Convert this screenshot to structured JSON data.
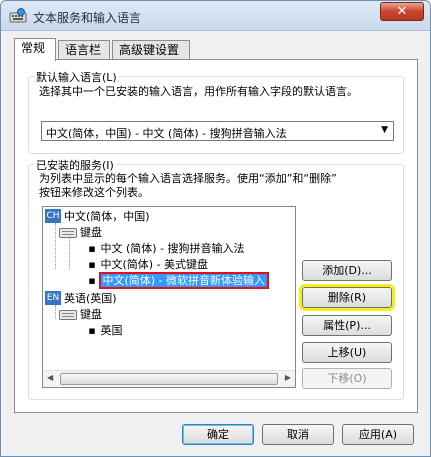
{
  "window": {
    "title": "文本服务和输入语言",
    "close_symbol": "✕"
  },
  "tabs": [
    {
      "label": "常规"
    },
    {
      "label": "语言栏"
    },
    {
      "label": "高级键设置"
    }
  ],
  "default_input": {
    "legend": "默认输入语言(L)",
    "description": "选择其中一个已安装的输入语言，用作所有输入字段的默认语言。",
    "selected": "中文(简体，中国) - 中文 (简体) - 搜狗拼音输入法"
  },
  "installed": {
    "legend": "已安装的服务(I)",
    "description_line1": "为列表中显示的每个输入语言选择服务。使用“添加”和“删除”",
    "description_line2": "按钮来修改这个列表。",
    "tree": {
      "lang1": {
        "badge": "CH",
        "label": "中文(简体，中国)"
      },
      "keyboard1": "键盘",
      "items1": [
        "中文 (简体) - 搜狗拼音输入法",
        "中文(简体) - 美式键盘",
        "中文(简体) - 微软拼音新体验输入"
      ],
      "lang2": {
        "badge": "EN",
        "label": "英语(英国)"
      },
      "keyboard2": "键盘",
      "items2": [
        "英国"
      ]
    }
  },
  "side_buttons": {
    "add": "添加(D)...",
    "remove": "删除(R)",
    "properties": "属性(P)...",
    "move_up": "上移(U)",
    "move_down": "下移(O)"
  },
  "footer_buttons": {
    "ok": "确定",
    "cancel": "取消",
    "apply": "应用(A)"
  },
  "colors": {
    "highlight_outline": "#e0101e",
    "annotation_outline": "#f5f011",
    "selection": "#3399ff"
  }
}
